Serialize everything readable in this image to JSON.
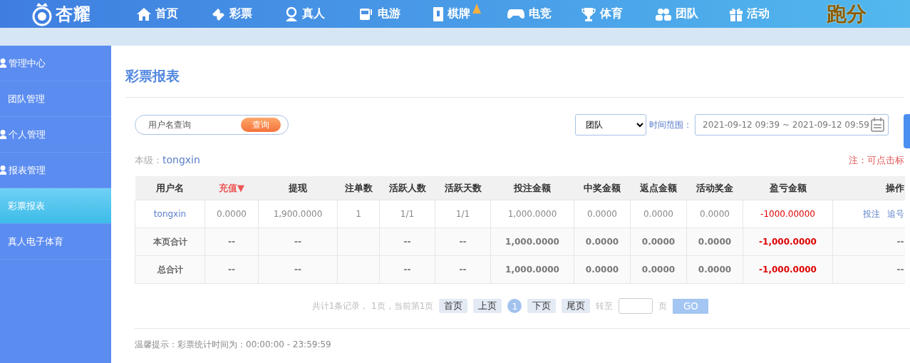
{
  "header": {
    "logo": "杏耀",
    "nav": [
      {
        "label": "首页"
      },
      {
        "label": "彩票"
      },
      {
        "label": "真人"
      },
      {
        "label": "电游"
      },
      {
        "label": "棋牌",
        "hot": true
      },
      {
        "label": "电竞"
      },
      {
        "label": "体育"
      },
      {
        "label": "团队"
      },
      {
        "label": "活动"
      }
    ],
    "promo": "跑分"
  },
  "sidebar": {
    "items": [
      {
        "kind": "section",
        "label": "管理中心",
        "selected": false
      },
      {
        "kind": "item",
        "label": "团队管理",
        "selected": false
      },
      {
        "kind": "section",
        "label": "个人管理",
        "selected": false
      },
      {
        "kind": "section",
        "label": "报表管理",
        "selected": false
      },
      {
        "kind": "item",
        "label": "彩票报表",
        "selected": true
      },
      {
        "kind": "item",
        "label": "真人电子体育",
        "selected": false
      }
    ]
  },
  "page_title": "彩票报表",
  "search": {
    "placeholder": "用户名查询",
    "button": "查询"
  },
  "filter": {
    "scope": "团队",
    "range_label": "时间范围：",
    "range": "2021-09-12 09:39 ~ 2021-09-12 09:59"
  },
  "level": {
    "label": "本级：",
    "user": "tongxin"
  },
  "note": "注：可点击标",
  "table": {
    "columns": [
      {
        "label": "用户名",
        "sorted": false
      },
      {
        "label": "充值▼",
        "sorted": true
      },
      {
        "label": "提现",
        "sorted": false
      },
      {
        "label": "注单数",
        "sorted": false
      },
      {
        "label": "活跃人数",
        "sorted": false
      },
      {
        "label": "活跃天数",
        "sorted": false
      },
      {
        "label": "投注金额",
        "sorted": false
      },
      {
        "label": "中奖金额",
        "sorted": false
      },
      {
        "label": "返点金额",
        "sorted": false
      },
      {
        "label": "活动奖金",
        "sorted": false
      },
      {
        "label": "盈亏金额",
        "sorted": false
      },
      {
        "label": "操作",
        "sorted": false
      }
    ],
    "rows": [
      {
        "kind": "data",
        "cells": [
          "tongxin",
          "0.0000",
          "1,900.0000",
          "1",
          "1/1",
          "1/1",
          "1,000.0000",
          "0.0000",
          "0.0000",
          "0.0000",
          "-1000.00000"
        ],
        "actions": [
          "投注",
          "追号"
        ]
      },
      {
        "kind": "total",
        "cells": [
          "本页合计",
          "--",
          "--",
          "",
          "--",
          "--",
          "1,000.0000",
          "0.0000",
          "0.0000",
          "0.0000",
          "-1,000.0000",
          "--"
        ]
      },
      {
        "kind": "total",
        "cells": [
          "总合计",
          "--",
          "--",
          "",
          "--",
          "--",
          "1,000.0000",
          "0.0000",
          "0.0000",
          "0.0000",
          "-1,000.0000",
          "--"
        ]
      }
    ]
  },
  "pagination": {
    "summary": "共计1条记录， 1页，当前第1页",
    "buttons": [
      {
        "label": "首页",
        "selected": false
      },
      {
        "label": "上页",
        "selected": false
      },
      {
        "label": "1",
        "selected": true
      },
      {
        "label": "下页",
        "selected": false
      },
      {
        "label": "尾页",
        "selected": false
      }
    ],
    "goto_label": "转至",
    "page_unit": "页",
    "go": "GO"
  },
  "tip": "温馨提示：彩票统计时间为：00:00:00 - 23:59:59"
}
